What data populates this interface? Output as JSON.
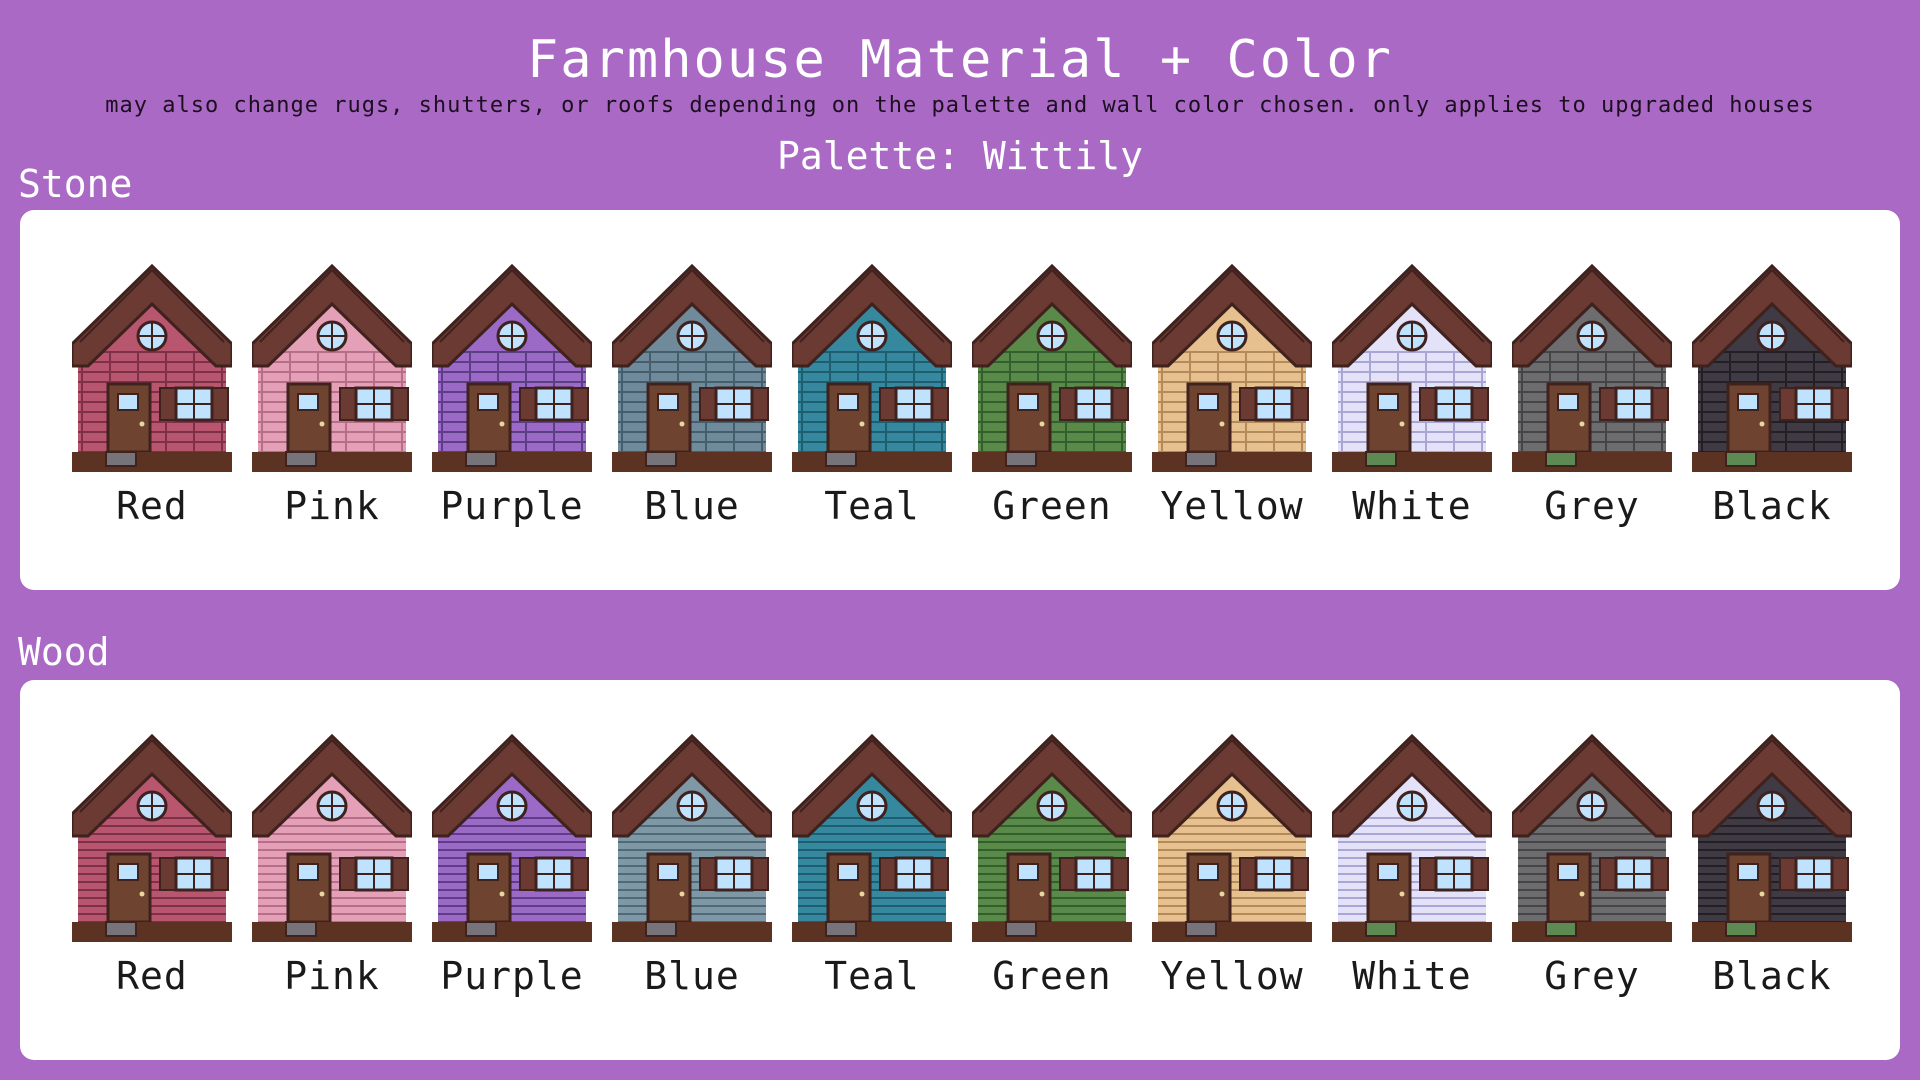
{
  "header": {
    "title": "Farmhouse Material + Color",
    "subtitle": "may also change rugs, shutters, or roofs depending on the palette and wall color chosen. only applies to upgraded houses",
    "palette_label": "Palette: Wittily"
  },
  "colors": {
    "background": "#ab69c6",
    "panel": "#ffffff",
    "roof": "#6b3a33",
    "roof_dark": "#3f211d",
    "door": "#6e4431",
    "window_glass": "#bfe3ff",
    "foundation": "#5c3322"
  },
  "sections": [
    {
      "label": "Stone",
      "material": "stone",
      "houses": [
        {
          "name": "Red",
          "wall": "#b9566f",
          "wall_line": "#7d3047",
          "mat": "#77737a"
        },
        {
          "name": "Pink",
          "wall": "#e4a0b7",
          "wall_line": "#b86d89",
          "mat": "#77737a"
        },
        {
          "name": "Purple",
          "wall": "#9a6ac6",
          "wall_line": "#5d3d86",
          "mat": "#77737a"
        },
        {
          "name": "Blue",
          "wall": "#6f8a9a",
          "wall_line": "#455e6c",
          "mat": "#77737a"
        },
        {
          "name": "Teal",
          "wall": "#36889e",
          "wall_line": "#1f5d70",
          "mat": "#77737a"
        },
        {
          "name": "Green",
          "wall": "#5a8a4a",
          "wall_line": "#335f2c",
          "mat": "#77737a"
        },
        {
          "name": "Yellow",
          "wall": "#e6c08e",
          "wall_line": "#b58a5a",
          "mat": "#77737a"
        },
        {
          "name": "White",
          "wall": "#e3e2f8",
          "wall_line": "#a9a6d3",
          "mat": "#5d8a52"
        },
        {
          "name": "Grey",
          "wall": "#6d6c6e",
          "wall_line": "#454446",
          "mat": "#5d8a52"
        },
        {
          "name": "Black",
          "wall": "#3f3a43",
          "wall_line": "#221f25",
          "mat": "#5d8a52"
        }
      ]
    },
    {
      "label": "Wood",
      "material": "wood",
      "houses": [
        {
          "name": "Red",
          "wall": "#b9566f",
          "wall_line": "#7d3047",
          "mat": "#77737a"
        },
        {
          "name": "Pink",
          "wall": "#e4a0b7",
          "wall_line": "#b86d89",
          "mat": "#77737a"
        },
        {
          "name": "Purple",
          "wall": "#9a6ac6",
          "wall_line": "#5d3d86",
          "mat": "#77737a"
        },
        {
          "name": "Blue",
          "wall": "#7f98a6",
          "wall_line": "#506978",
          "mat": "#77737a"
        },
        {
          "name": "Teal",
          "wall": "#36889e",
          "wall_line": "#1f5d70",
          "mat": "#77737a"
        },
        {
          "name": "Green",
          "wall": "#5a8a4a",
          "wall_line": "#335f2c",
          "mat": "#77737a"
        },
        {
          "name": "Yellow",
          "wall": "#e6c08e",
          "wall_line": "#b58a5a",
          "mat": "#77737a"
        },
        {
          "name": "White",
          "wall": "#e3e2f8",
          "wall_line": "#a9a6d3",
          "mat": "#5d8a52"
        },
        {
          "name": "Grey",
          "wall": "#6d6c6e",
          "wall_line": "#454446",
          "mat": "#5d8a52"
        },
        {
          "name": "Black",
          "wall": "#3f3a43",
          "wall_line": "#221f25",
          "mat": "#5d8a52"
        }
      ]
    }
  ]
}
